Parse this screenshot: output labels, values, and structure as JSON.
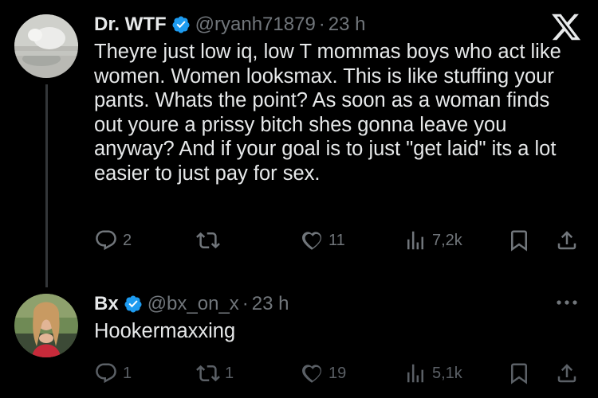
{
  "tweets": [
    {
      "display_name": "Dr. WTF",
      "handle": "@ryanh71879",
      "separator": "·",
      "time": "23 h",
      "text": "Theyre just low iq, low T mommas boys who act like women. Women looksmax. This is like stuffing your pants. Whats the point? As soon as a woman finds out youre a prissy bitch shes gonna leave you anyway? And if your goal is to just \"get laid\" its a lot easier to just pay for sex.",
      "corner_icon": "x-logo-icon",
      "replies": "2",
      "retweets": "",
      "likes": "11",
      "views": "7,2k"
    },
    {
      "display_name": "Bx",
      "handle": "@bx_on_x",
      "separator": "·",
      "time": "23 h",
      "text": "Hookermaxxing",
      "corner_icon": "more-icon",
      "replies": "1",
      "retweets": "1",
      "likes": "19",
      "views": "5,1k"
    }
  ],
  "colors": {
    "background": "#000000",
    "text": "#e7e9ea",
    "muted": "#71767b",
    "verified": "#1d9bf0",
    "thread_line": "#333639"
  }
}
